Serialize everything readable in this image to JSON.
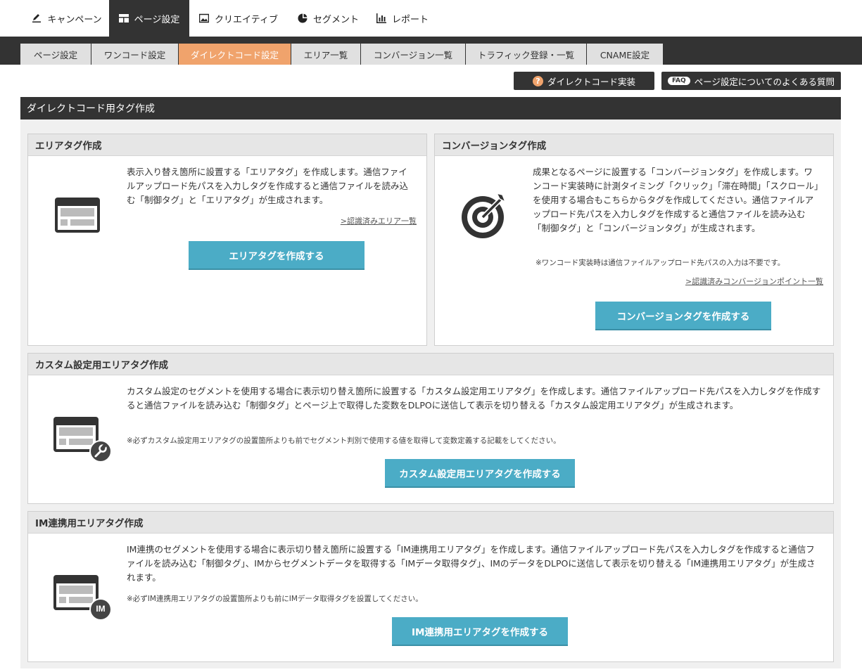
{
  "topnav": [
    {
      "label": "キャンペーン",
      "icon": "edit-icon"
    },
    {
      "label": "ページ設定",
      "icon": "layout-icon"
    },
    {
      "label": "クリエイティブ",
      "icon": "image-icon"
    },
    {
      "label": "セグメント",
      "icon": "pie-chart-icon"
    },
    {
      "label": "レポート",
      "icon": "bar-chart-icon"
    }
  ],
  "subnav": [
    {
      "label": "ページ設定"
    },
    {
      "label": "ワンコード設定"
    },
    {
      "label": "ダイレクトコード設定"
    },
    {
      "label": "エリア一覧"
    },
    {
      "label": "コンバージョン一覧"
    },
    {
      "label": "トラフィック登録・一覧"
    },
    {
      "label": "CNAME設定"
    }
  ],
  "actions": {
    "direct_code_label": "ダイレクトコード実装",
    "faq_badge": "FAQ",
    "faq_label": "ページ設定についてのよくある質問"
  },
  "main": {
    "title": "ダイレクトコード用タグ作成"
  },
  "area_tag": {
    "title": "エリアタグ作成",
    "description": "表示入り替え箇所に設置する「エリアタグ」を作成します。通信ファイルアップロード先パスを入力しタグを作成すると通信ファイルを読み込む「制御タグ」と「エリアタグ」が生成されます。",
    "link": ">認識済みエリア一覧",
    "button": "エリアタグを作成する"
  },
  "conversion_tag": {
    "title": "コンバージョンタグ作成",
    "description": "成果となるページに設置する「コンバージョンタグ」を作成します。ワンコード実装時に計測タイミング「クリック」「滞在時間」「スクロール」を使用する場合もこちらからタグを作成してください。通信ファイルアップロード先パスを入力しタグを作成すると通信ファイルを読み込む「制御タグ」と「コンバージョンタグ」が生成されます。",
    "note": "※ワンコード実装時は通信ファイルアップロード先パスの入力は不要です。",
    "link": ">認識済みコンバージョンポイント一覧",
    "button": "コンバージョンタグを作成する"
  },
  "custom_area_tag": {
    "title": "カスタム設定用エリアタグ作成",
    "description": "カスタム設定のセグメントを使用する場合に表示切り替え箇所に設置する「カスタム設定用エリアタグ」を作成します。通信ファイルアップロード先パスを入力しタグを作成すると通信ファイルを読み込む「制御タグ」とページ上で取得した変数をDLPOに送信して表示を切り替える「カスタム設定用エリアタグ」が生成されます。",
    "note": "※必ずカスタム設定用エリアタグの設置箇所よりも前でセグメント判別で使用する値を取得して変数定義する記載をしてください。",
    "button": "カスタム設定用エリアタグを作成する"
  },
  "im_area_tag": {
    "title": "IM連携用エリアタグ作成",
    "description": "IM連携のセグメントを使用する場合に表示切り替え箇所に設置する「IM連携用エリアタグ」を作成します。通信ファイルアップロード先パスを入力しタグを作成すると通信ファイルを読み込む「制御タグ」、IMからセグメントデータを取得する「IMデータ取得タグ」、IMのデータをDLPOに送信して表示を切り替える「IM連携用エリアタグ」が生成されます。",
    "note": "※必ずIM連携用エリアタグの設置箇所よりも前にIMデータ取得タグを設置してください。",
    "badge": "IM",
    "button": "IM連携用エリアタグを作成する"
  },
  "colors": {
    "dark": "#333333",
    "accent_orange": "#f0a36c",
    "button_teal": "#4bacc6",
    "panel_bg": "#f0f0f0"
  }
}
